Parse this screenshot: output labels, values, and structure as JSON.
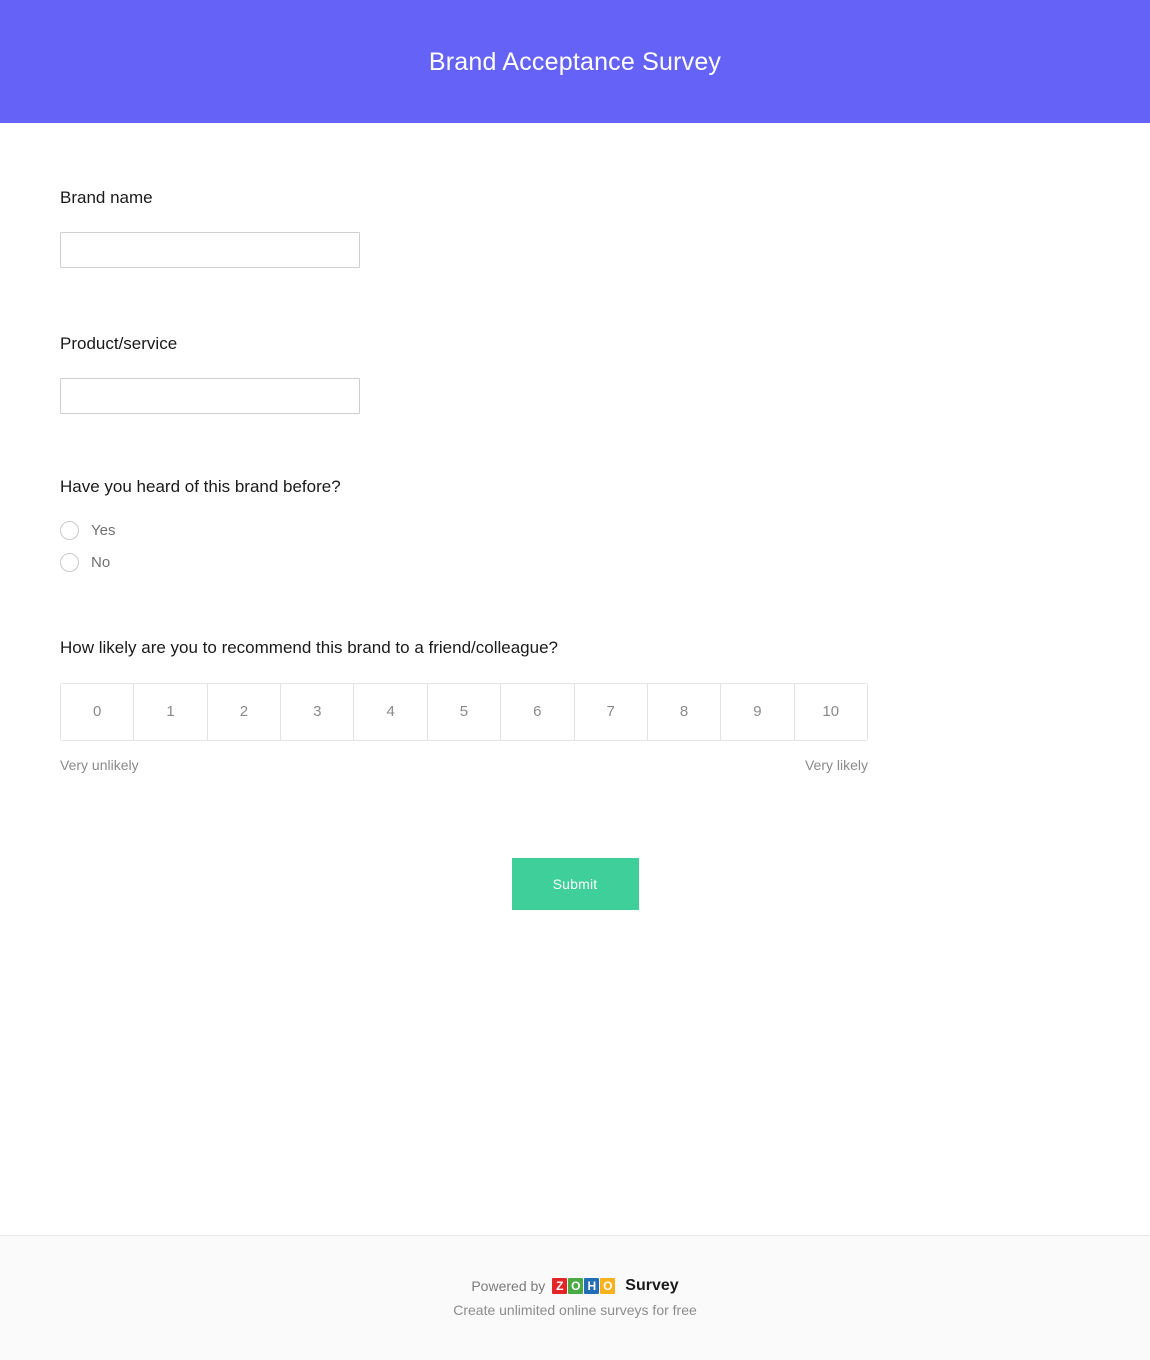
{
  "header": {
    "title": "Brand Acceptance Survey",
    "background_color": "#6563f7",
    "text_color": "#ffffff"
  },
  "questions": [
    {
      "id": "brand-name",
      "label": "Brand name",
      "type": "text",
      "value": "",
      "placeholder": ""
    },
    {
      "id": "product-service",
      "label": "Product/service",
      "type": "text",
      "value": "",
      "placeholder": ""
    },
    {
      "id": "heard-of-brand",
      "label": "Have you heard of this brand before?",
      "type": "radio",
      "options": [
        {
          "label": "Yes",
          "selected": false
        },
        {
          "label": "No",
          "selected": false
        }
      ]
    },
    {
      "id": "recommend-likelihood",
      "label": "How likely are you to recommend this brand to a friend/colleague?",
      "type": "scale",
      "values": [
        "0",
        "1",
        "2",
        "3",
        "4",
        "5",
        "6",
        "7",
        "8",
        "9",
        "10"
      ],
      "selected": null,
      "anchor_left": "Very unlikely",
      "anchor_right": "Very likely"
    }
  ],
  "submit": {
    "label": "Submit",
    "color": "#3ecf9a"
  },
  "footer": {
    "powered_by": "Powered by",
    "brand_tiles": [
      "Z",
      "O",
      "H",
      "O"
    ],
    "brand_word": "Survey",
    "tagline": "Create unlimited online surveys for free"
  }
}
